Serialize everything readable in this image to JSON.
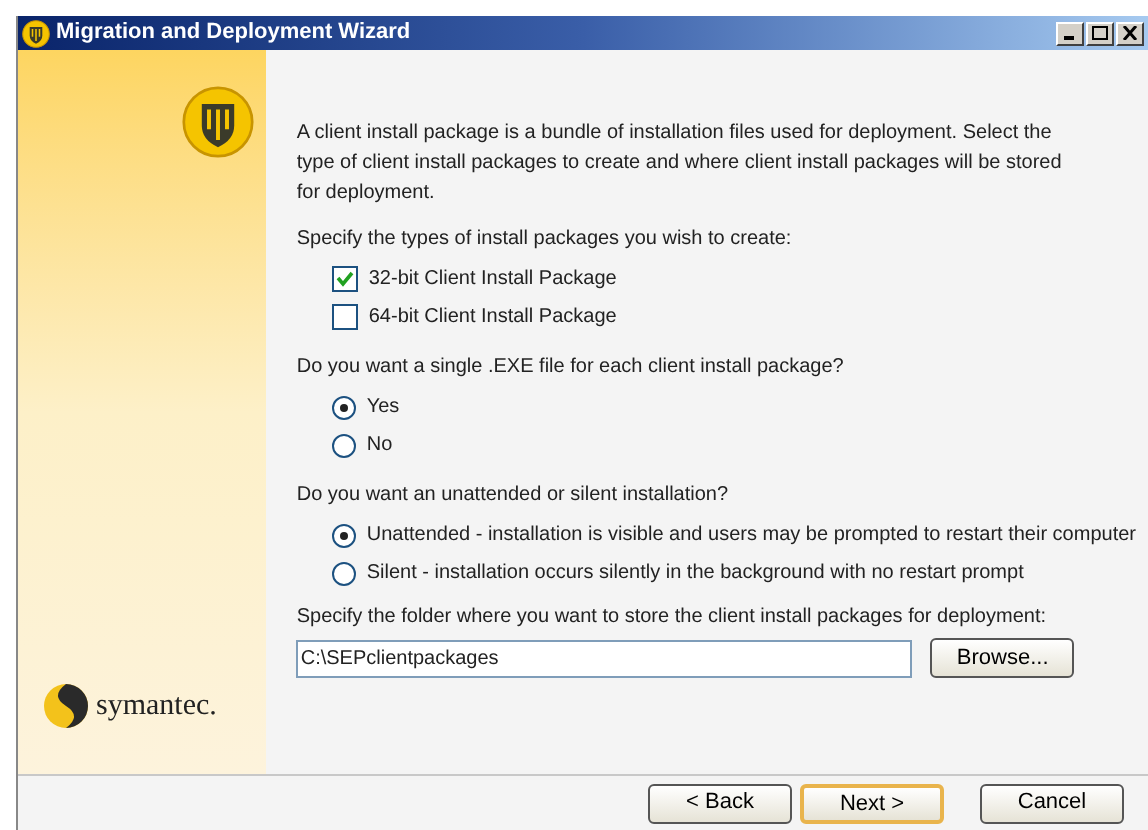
{
  "window": {
    "title": "Migration and Deployment Wizard"
  },
  "intro": "A client install package is a bundle of installation files used for deployment. Select the type of client install packages to create and where client install packages will be stored for deployment.",
  "brand": "symantec.",
  "sections": [
    {
      "question": "Specify the types of install packages you wish to create:",
      "options": [
        {
          "kind": "checkbox",
          "label": "32-bit Client Install Package",
          "checked": true
        },
        {
          "kind": "checkbox",
          "label": "64-bit Client Install Package",
          "checked": false
        }
      ]
    },
    {
      "question": "Do you want a single .EXE file for each client install package?",
      "options": [
        {
          "kind": "radio",
          "label": "Yes",
          "selected": true
        },
        {
          "kind": "radio",
          "label": "No",
          "selected": false
        }
      ]
    },
    {
      "question": "Do you want an unattended or silent installation?",
      "options": [
        {
          "kind": "radio",
          "label": "Unattended - installation is visible and users may be prompted to restart their computer",
          "selected": true
        },
        {
          "kind": "radio",
          "label": "Silent - installation occurs silently in the background with no restart prompt",
          "selected": false
        }
      ]
    }
  ],
  "folder": {
    "label": "Specify the folder where you want to store the client install packages for deployment:",
    "value": "C:\\SEPclientpackages",
    "browse": "Browse..."
  },
  "buttons": [
    {
      "label": "< Back",
      "default": false
    },
    {
      "label": "Next >",
      "default": true
    },
    {
      "label": "Cancel",
      "default": false
    }
  ]
}
